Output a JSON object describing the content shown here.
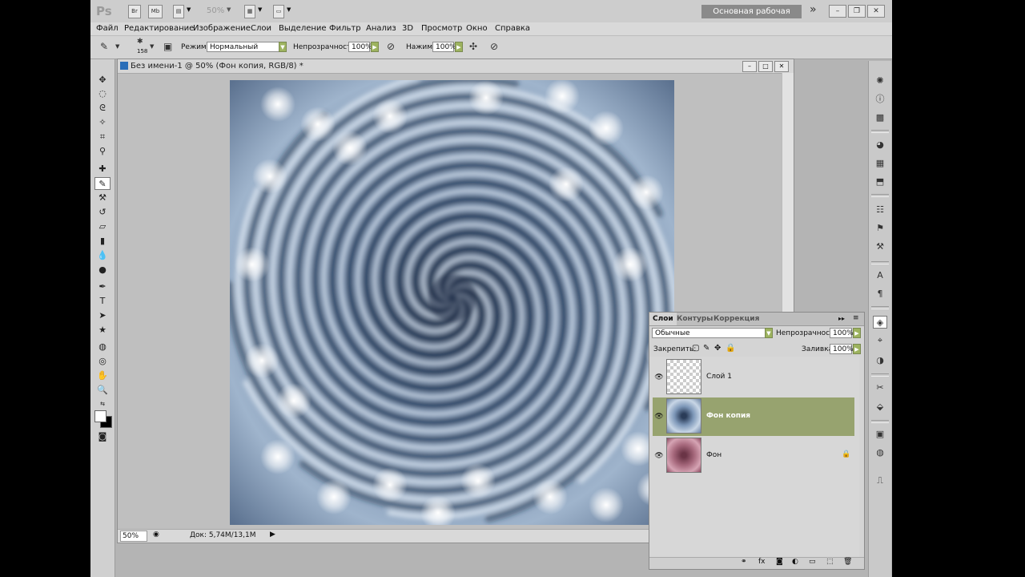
{
  "app": {
    "logo": "Ps",
    "appbar_buttons": [
      "Br",
      "Mb"
    ],
    "zoom": "50%",
    "workspace": "Основная рабочая среда",
    "more": "»"
  },
  "menu": [
    "Файл",
    "Редактирование",
    "Изображение",
    "Слои",
    "Выделение",
    "Фильтр",
    "Анализ",
    "3D",
    "Просмотр",
    "Окно",
    "Справка"
  ],
  "options": {
    "brush_size": "158",
    "mode_label": "Режим:",
    "mode_value": "Нормальный",
    "opacity_label": "Непрозрачность:",
    "opacity_value": "100%",
    "flow_label": "Нажим:",
    "flow_value": "100%"
  },
  "document": {
    "title": "Без имени-1 @ 50% (Фон копия, RGB/8) *",
    "status_zoom": "50%",
    "status_doc": "Док: 5,74M/13,1M"
  },
  "layers_panel": {
    "tabs": [
      "Слои",
      "Контуры",
      "Коррекция"
    ],
    "blend_mode": "Обычные",
    "opacity_label": "Непрозрачность:",
    "opacity_value": "100%",
    "lock_label": "Закрепить:",
    "fill_label": "Заливка:",
    "fill_value": "100%",
    "layers": [
      {
        "name": "Слой 1",
        "selected": false,
        "locked": false
      },
      {
        "name": "Фон копия",
        "selected": true,
        "locked": false
      },
      {
        "name": "Фон",
        "selected": false,
        "locked": true
      }
    ]
  },
  "colors": {
    "selected_layer": "#97a36f",
    "accent_button": "#9db35f",
    "swirl_light": "#e8f0f8",
    "swirl_dark": "#1c2c44"
  }
}
